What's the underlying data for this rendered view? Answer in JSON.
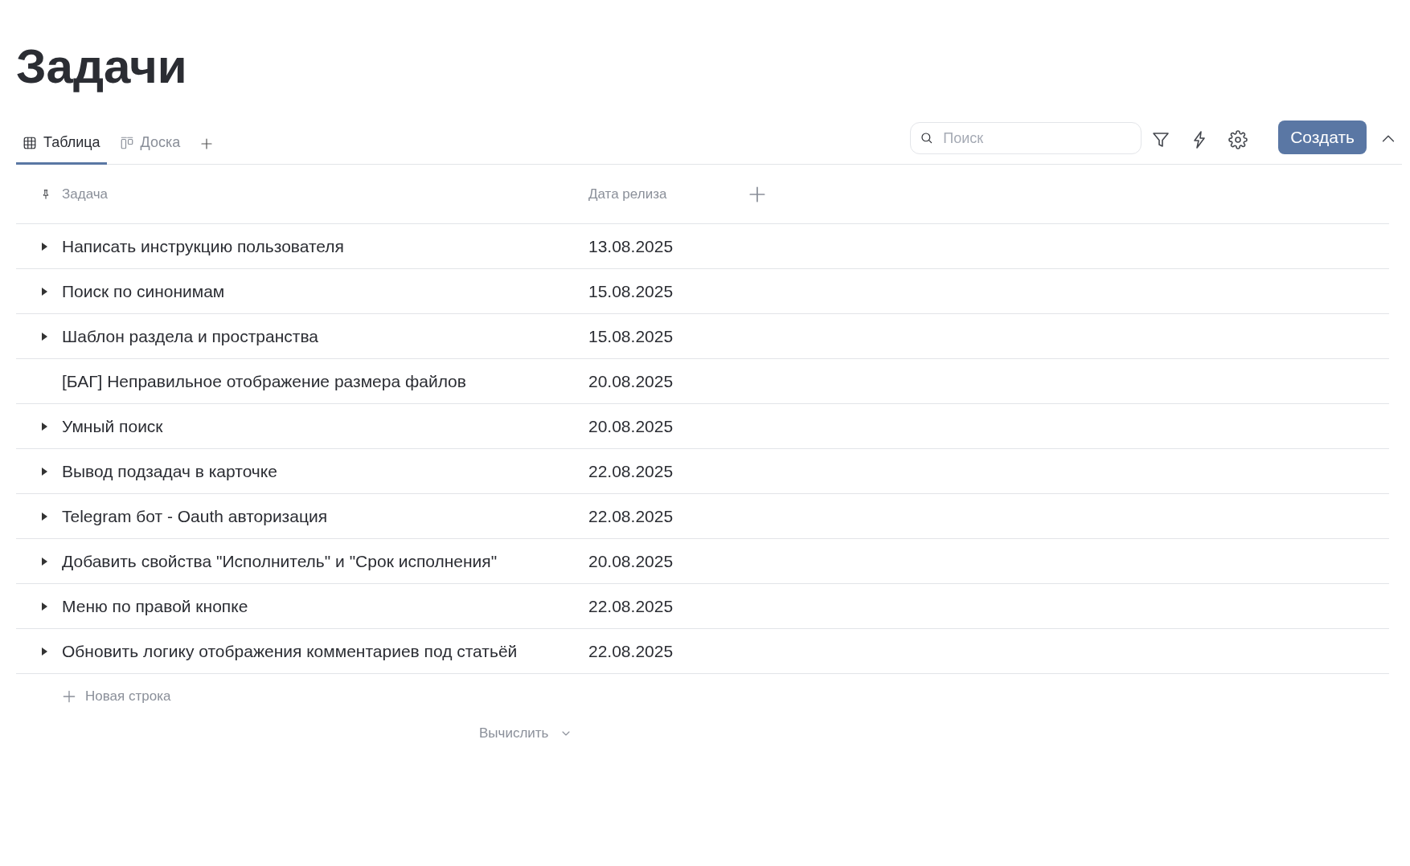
{
  "page_title": "Задачи",
  "tabs": [
    {
      "label": "Таблица",
      "kind": "table",
      "selected": true
    },
    {
      "label": "Доска",
      "kind": "board",
      "selected": false
    }
  ],
  "search": {
    "placeholder": "Поиск"
  },
  "create_button": "Создать",
  "table": {
    "columns": [
      "Задача",
      "Дата релиза"
    ],
    "rows": [
      {
        "task": "Написать инструкцию пользователя",
        "date": "13.08.2025",
        "expandable": true
      },
      {
        "task": "Поиск по синонимам",
        "date": "15.08.2025",
        "expandable": true
      },
      {
        "task": "Шаблон раздела и пространства",
        "date": "15.08.2025",
        "expandable": true
      },
      {
        "task": "[БАГ] Неправильное отображение размера файлов",
        "date": "20.08.2025",
        "expandable": false
      },
      {
        "task": "Умный поиск",
        "date": "20.08.2025",
        "expandable": true
      },
      {
        "task": "Вывод подзадач в карточке",
        "date": "22.08.2025",
        "expandable": true
      },
      {
        "task": "Telegram бот - Oauth авторизация",
        "date": "22.08.2025",
        "expandable": true
      },
      {
        "task": "Добавить свойства \"Исполнитель\" и \"Срок исполнения\"",
        "date": "20.08.2025",
        "expandable": true
      },
      {
        "task": "Меню по правой кнопке",
        "date": "22.08.2025",
        "expandable": true
      },
      {
        "task": "Обновить логику отображения комментариев под статьёй",
        "date": "22.08.2025",
        "expandable": true
      }
    ],
    "new_row": "Новая строка",
    "calculate": "Вычислить"
  }
}
